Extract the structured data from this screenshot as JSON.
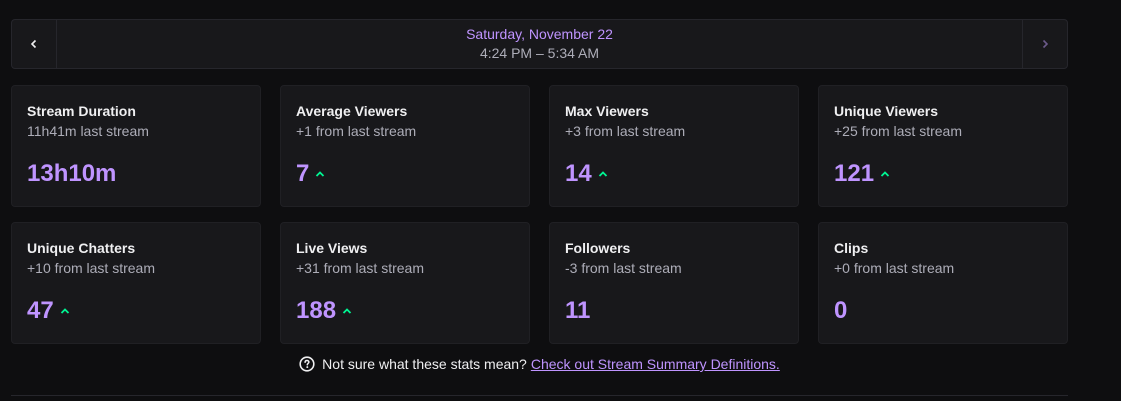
{
  "header": {
    "date": "Saturday, November 22",
    "time_range": "4:24 PM – 5:34 AM",
    "prev_icon": "chevron-left-icon",
    "next_icon": "chevron-right-icon"
  },
  "colors": {
    "accent": "#bf94ff",
    "up": "#00f593",
    "muted": "#adadb8"
  },
  "stats": [
    {
      "title": "Stream Duration",
      "sub": "11h41m last stream",
      "value": "13h10m",
      "trend": "none"
    },
    {
      "title": "Average Viewers",
      "sub": "+1 from last stream",
      "value": "7",
      "trend": "up"
    },
    {
      "title": "Max Viewers",
      "sub": "+3 from last stream",
      "value": "14",
      "trend": "up"
    },
    {
      "title": "Unique Viewers",
      "sub": "+25 from last stream",
      "value": "121",
      "trend": "up"
    },
    {
      "title": "Unique Chatters",
      "sub": "+10 from last stream",
      "value": "47",
      "trend": "up"
    },
    {
      "title": "Live Views",
      "sub": "+31 from last stream",
      "value": "188",
      "trend": "up"
    },
    {
      "title": "Followers",
      "sub": "-3 from last stream",
      "value": "11",
      "trend": "none"
    },
    {
      "title": "Clips",
      "sub": "+0 from last stream",
      "value": "0",
      "trend": "none"
    }
  ],
  "footer": {
    "text": "Not sure what these stats mean?",
    "link": "Check out Stream Summary Definitions.",
    "icon": "help-circle-icon"
  }
}
